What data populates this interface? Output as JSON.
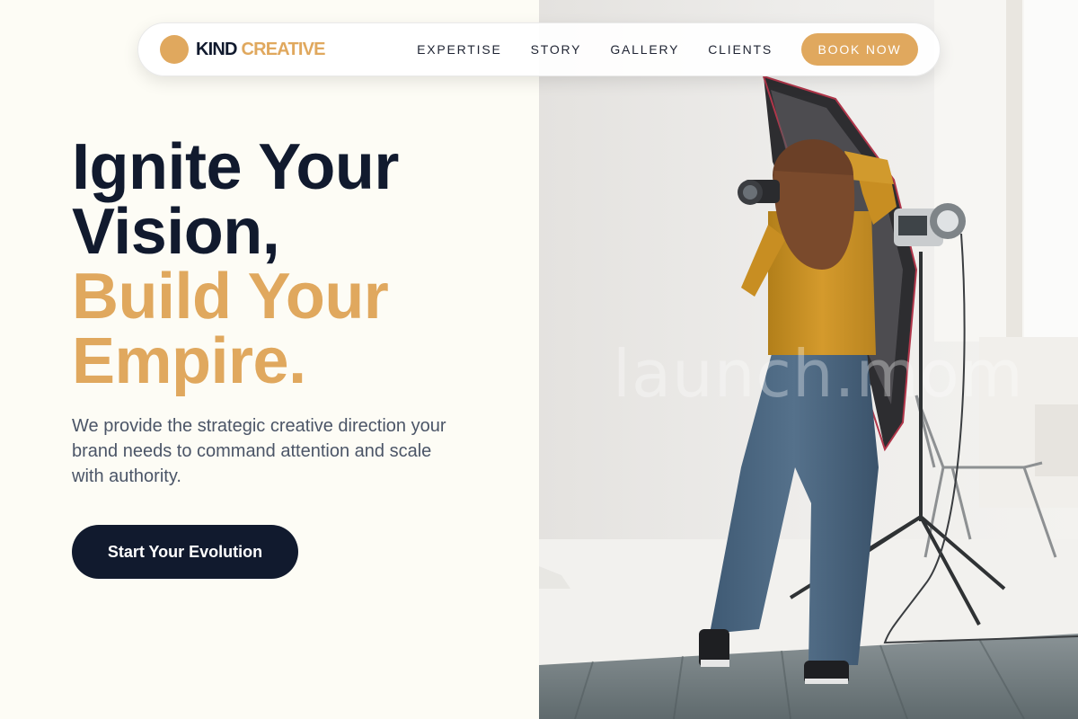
{
  "brand": {
    "name_primary": "KIND",
    "name_accent": "CREATIVE"
  },
  "nav": {
    "links": [
      "EXPERTISE",
      "STORY",
      "GALLERY",
      "CLIENTS"
    ],
    "cta_label": "BOOK NOW"
  },
  "hero": {
    "headline_lines": [
      "Ignite Your",
      "Vision,"
    ],
    "headline_accent_lines": [
      "Build Your",
      "Empire."
    ],
    "subtext": "We provide the strategic creative direction your brand needs to command attention and scale with authority.",
    "cta_label": "Start Your Evolution"
  },
  "photo": {
    "description_icon": "photographer-studio-photo",
    "watermark": "launch.mom"
  },
  "colors": {
    "accent": "#e0a85e",
    "dark": "#111a2e",
    "background": "#fdfcf5",
    "body_text": "#4b5567"
  }
}
